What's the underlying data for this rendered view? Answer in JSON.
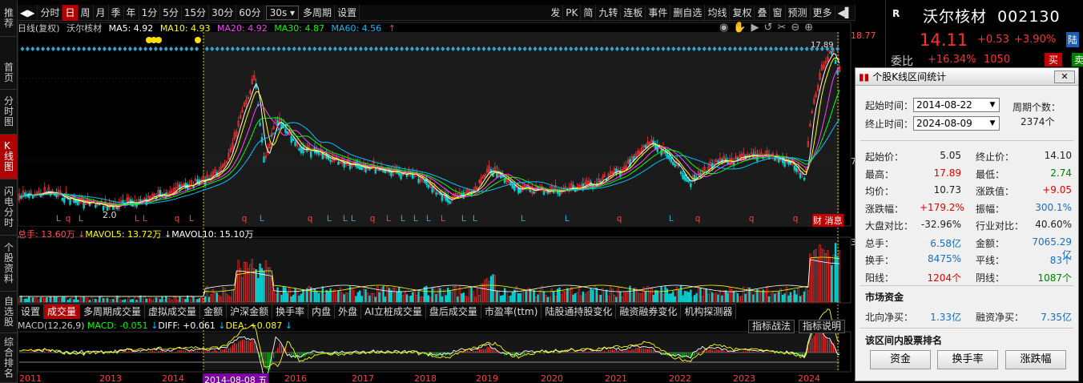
{
  "leftnav": [
    {
      "label": "推荐"
    },
    {
      "label": "首页"
    },
    {
      "label": "分时图"
    },
    {
      "label": "K线图",
      "active": true
    },
    {
      "label": "闪电分时"
    },
    {
      "label": "个股资料"
    },
    {
      "label": "自选股"
    },
    {
      "label": "综合排名"
    }
  ],
  "toolbar": {
    "left": [
      "分时",
      "日",
      "周",
      "月",
      "季",
      "年",
      "1分",
      "5分",
      "15分",
      "30分",
      "60分"
    ],
    "selected": "日",
    "period": "30s ▾",
    "multi": "多周期",
    "settings": "设置",
    "right": [
      "发",
      "PK",
      "简",
      "九转",
      "连板",
      "事件",
      "删自选",
      "均线",
      "复权",
      "叠",
      "窗",
      "预测",
      "更多"
    ]
  },
  "mahdr": {
    "prefix": "日线(复权)",
    "stock": "沃尔核材",
    "ma5": "MA5: 4.92",
    "ma10": "MA10: 4.93",
    "ma20": "MA20: 4.92",
    "ma30": "MA30: 4.87",
    "ma60": "MA60: 4.56",
    "arrow": "↑"
  },
  "axis": {
    "top": "18.77",
    "mid": "7",
    "vol_top": "3"
  },
  "chart_labels": {
    "low": "2.0",
    "high": "17.89",
    "caibao": "财 消息"
  },
  "vol": {
    "total": "总手: 13.60万",
    "mavol5": "MAVOL5: 13.72万",
    "mavol10": "MAVOL10: 15.10万"
  },
  "tabs": [
    "设置",
    "成交量",
    "多周期成交量",
    "虚拟成交量",
    "金额",
    "沪深金额",
    "换手率",
    "内盘",
    "外盘",
    "AI立桩成交量",
    "盘后成交量",
    "市盈率(ttm)",
    "陆股通持股变化",
    "融资融券变化",
    "机构探测器"
  ],
  "tab_selected": "成交量",
  "macd": {
    "name": "MACD(12,26,9)",
    "macd": "MACD: -0.051",
    "diff": "DIFF: +0.061",
    "dea": "DEA: +0.087"
  },
  "ind_buttons": {
    "strategy": "指标战法",
    "help": "指标说明"
  },
  "years": [
    "2011",
    "2013",
    "2014",
    "2014-08-08 五",
    "2016",
    "2017",
    "2018",
    "2019",
    "2020",
    "2021",
    "2022",
    "2023",
    "2024"
  ],
  "quote": {
    "market": "R",
    "name": "沃尔核材",
    "code": "002130",
    "price": "14.11",
    "change": "+0.53",
    "pct": "+3.90%",
    "tag": "陆",
    "weibi_label": "委比",
    "weibi": "+16.34%",
    "weicha": "1050",
    "buy": "买",
    "sell": "卖"
  },
  "dialog": {
    "title": "个股K线区间统计",
    "close": "✕",
    "start_label": "起始时间：",
    "start": "2014-08-22",
    "end_label": "终止时间：",
    "end": "2024-08-09",
    "period_label": "周期个数：",
    "period_count": "2374个",
    "rows": [
      {
        "l1": "起始价：",
        "v1": "5.05",
        "c1": "black",
        "l2": "终止价：",
        "v2": "14.10",
        "c2": "black"
      },
      {
        "l1": "最高：",
        "v1": "17.89",
        "c1": "red",
        "l2": "最低：",
        "v2": "2.74",
        "c2": "green"
      },
      {
        "l1": "均价：",
        "v1": "10.73",
        "c1": "black",
        "l2": "涨跌值：",
        "v2": "+9.05",
        "c2": "red"
      },
      {
        "l1": "涨跌幅：",
        "v1": "+179.2%",
        "c1": "red",
        "l2": "振幅：",
        "v2": "300.1%",
        "c2": "blue"
      },
      {
        "l1": "大盘对比：",
        "v1": "-32.96%",
        "c1": "black",
        "l2": "行业对比：",
        "v2": "40.60%",
        "c2": "black"
      },
      {
        "l1": "总手：",
        "v1": "6.58亿",
        "c1": "blue",
        "l2": "金额：",
        "v2": "7065.29亿",
        "c2": "blue"
      },
      {
        "l1": "换手：",
        "v1": "8475%",
        "c1": "blue",
        "l2": "平线：",
        "v2": "83个",
        "c2": "blue"
      },
      {
        "l1": "阳线：",
        "v1": "1204个",
        "c1": "red",
        "l2": "阴线：",
        "v2": "1087个",
        "c2": "green"
      }
    ],
    "fund_title": "市场资金",
    "north_label": "北向净买：",
    "north": "1.33亿",
    "margin_label": "融资净买：",
    "margin": "7.35亿",
    "rank_title": "该区间内股票排名",
    "btn_fund": "资金",
    "btn_turnover": "换手率",
    "btn_change": "涨跌幅"
  },
  "colors": {
    "up": "#ff3030",
    "down": "#00d0d0",
    "ma5": "#ffffff",
    "ma10": "#ffff00",
    "ma20": "#ff40ff",
    "ma30": "#00ff00",
    "ma60": "#00c0ff"
  }
}
